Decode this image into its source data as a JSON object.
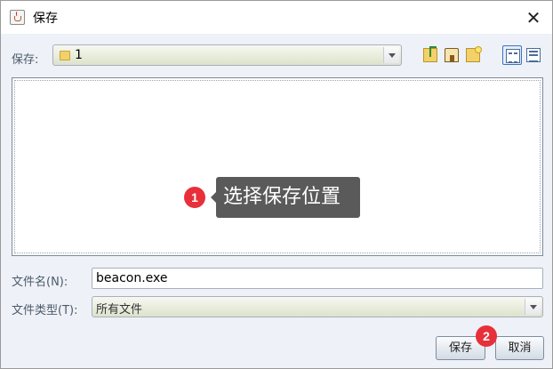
{
  "window": {
    "title": "保存",
    "close_glyph": "✕"
  },
  "toolbar": {
    "look_in_label": "保存:",
    "look_in_value": "1",
    "icons": [
      "up-one-level-icon",
      "home-icon",
      "new-folder-icon",
      "list-view-icon",
      "details-view-icon"
    ]
  },
  "annotations": {
    "marker_1": "1",
    "tooltip_1": "选择保存位置",
    "marker_2": "2"
  },
  "form": {
    "filename_label": "文件名(N):",
    "filename_value": "beacon.exe",
    "filetype_label": "文件类型(T):",
    "filetype_value": "所有文件"
  },
  "buttons": {
    "save_label": "保存",
    "cancel_label": "取消"
  },
  "colors": {
    "marker": "#e8303a",
    "tooltip_bg": "#5a5a5a",
    "dialog_bg": "#eef1f7"
  }
}
